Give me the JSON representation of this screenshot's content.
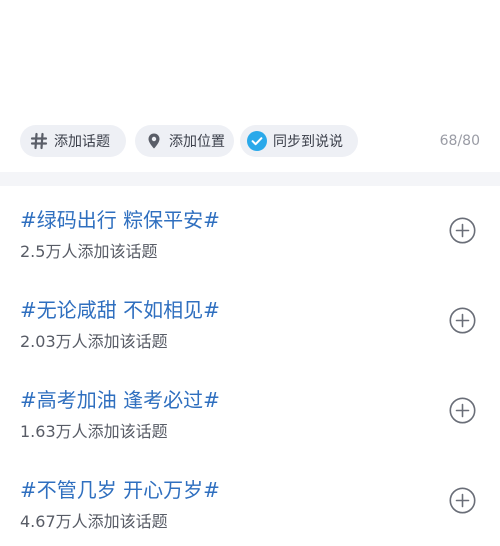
{
  "toolbar": {
    "topic_label": "添加话题",
    "location_label": "添加位置",
    "sync_label": "同步到说说",
    "char_counter": "68/80"
  },
  "topics": [
    {
      "title": "#绿码出行 粽保平安#",
      "count": "2.5万人添加该话题"
    },
    {
      "title": "#无论咸甜 不如相见#",
      "count": "2.03万人添加该话题"
    },
    {
      "title": "#高考加油 逢考必过#",
      "count": "1.63万人添加该话题"
    },
    {
      "title": "#不管几岁 开心万岁#",
      "count": "4.67万人添加该话题"
    }
  ],
  "icons": {
    "topic": "hash-icon",
    "location": "location-pin-icon",
    "sync": "check-circle-icon",
    "add": "plus-circle-icon"
  },
  "colors": {
    "topic_title": "#2f6fbf",
    "sync_check": "#2aa9ea",
    "chip_bg": "#eef0f5"
  }
}
